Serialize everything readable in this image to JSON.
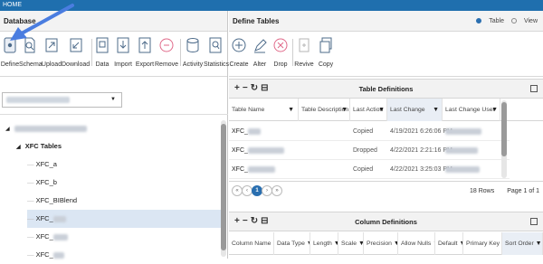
{
  "app": {
    "title": "HOME"
  },
  "left": {
    "section_title": "Database",
    "toolbar": [
      {
        "label": "Define",
        "icon": "database-define-icon"
      },
      {
        "label": "Schema",
        "icon": "schema-icon"
      },
      {
        "label": "Upload",
        "icon": "upload-icon"
      },
      {
        "label": "Download",
        "icon": "download-icon"
      },
      {
        "label": "Data",
        "icon": "data-icon"
      },
      {
        "label": "Import",
        "icon": "import-icon"
      },
      {
        "label": "Export",
        "icon": "export-icon"
      },
      {
        "label": "Remove",
        "icon": "remove-icon"
      },
      {
        "label": "Activity",
        "icon": "activity-icon"
      },
      {
        "label": "Statistics",
        "icon": "statistics-icon"
      }
    ],
    "tree": {
      "group_label": "XFC Tables",
      "items": [
        "XFC_a",
        "XFC_b",
        "XFC_BIBlend",
        "XFC_",
        "XFC_",
        "XFC_"
      ]
    }
  },
  "right": {
    "section_title": "Define Tables",
    "view_options": [
      "Table",
      "View"
    ],
    "selected_view": "Table",
    "toolbar": [
      {
        "label": "Create",
        "icon": "plus-circle-icon"
      },
      {
        "label": "Alter",
        "icon": "pencil-icon"
      },
      {
        "label": "Drop",
        "icon": "x-circle-icon"
      },
      {
        "label": "Revive",
        "icon": "revive-icon"
      },
      {
        "label": "Copy",
        "icon": "copy-icon"
      }
    ],
    "table_definitions": {
      "title": "Table Definitions",
      "columns": [
        "Table Name",
        "Table Description",
        "Last Action",
        "Last Change",
        "Last Change User"
      ],
      "rows": [
        {
          "name": "XFC_",
          "action": "Copied",
          "change": "4/19/2021 6:26:06 PM"
        },
        {
          "name": "XFC_",
          "action": "Dropped",
          "change": "4/22/2021 2:21:16 PM"
        },
        {
          "name": "XFC_",
          "action": "Copied",
          "change": "4/22/2021 3:25:03 PM"
        }
      ],
      "pager": {
        "current_page": "1",
        "rows_text": "18 Rows",
        "page_text": "Page  1  of 1"
      }
    },
    "column_definitions": {
      "title": "Column Definitions",
      "columns": [
        "Column Name",
        "Data Type",
        "Length",
        "Scale",
        "Precision",
        "Allow Nulls",
        "Default",
        "Primary Key",
        "Sort Order"
      ]
    }
  },
  "colors": {
    "topbar": "#1f6fae",
    "accent": "#2a6fb0",
    "selection": "#dbe6f3",
    "annotation_arrow": "#4a7de0"
  }
}
